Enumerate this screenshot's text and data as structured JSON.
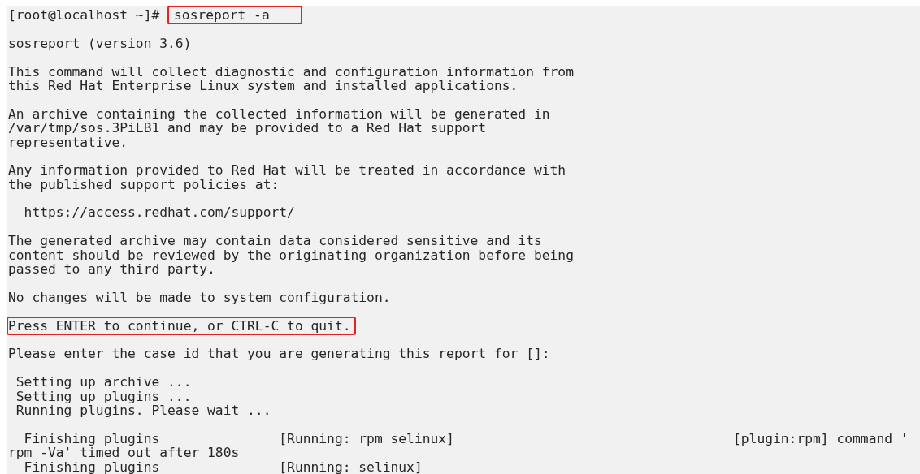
{
  "terminal": {
    "lines": [
      {
        "kind": "prompt",
        "prompt": "[root@localhost ~]#",
        "command": "sosreport -a",
        "highlighted": true
      },
      {
        "kind": "blank"
      },
      {
        "kind": "output",
        "text": "sosreport (version 3.6)",
        "highlighted": false
      },
      {
        "kind": "blank"
      },
      {
        "kind": "output",
        "text": "This command will collect diagnostic and configuration information from",
        "highlighted": false
      },
      {
        "kind": "output",
        "text": "this Red Hat Enterprise Linux system and installed applications.",
        "highlighted": false
      },
      {
        "kind": "blank"
      },
      {
        "kind": "output",
        "text": "An archive containing the collected information will be generated in",
        "highlighted": false
      },
      {
        "kind": "output",
        "text": "/var/tmp/sos.3PiLB1 and may be provided to a Red Hat support",
        "highlighted": false
      },
      {
        "kind": "output",
        "text": "representative.",
        "highlighted": false
      },
      {
        "kind": "blank"
      },
      {
        "kind": "output",
        "text": "Any information provided to Red Hat will be treated in accordance with",
        "highlighted": false
      },
      {
        "kind": "output",
        "text": "the published support policies at:",
        "highlighted": false
      },
      {
        "kind": "blank"
      },
      {
        "kind": "output",
        "text": "  https://access.redhat.com/support/",
        "highlighted": false
      },
      {
        "kind": "blank"
      },
      {
        "kind": "output",
        "text": "The generated archive may contain data considered sensitive and its",
        "highlighted": false
      },
      {
        "kind": "output",
        "text": "content should be reviewed by the originating organization before being",
        "highlighted": false
      },
      {
        "kind": "output",
        "text": "passed to any third party.",
        "highlighted": false
      },
      {
        "kind": "blank"
      },
      {
        "kind": "output",
        "text": "No changes will be made to system configuration.",
        "highlighted": false
      },
      {
        "kind": "blank"
      },
      {
        "kind": "output",
        "text": "Press ENTER to continue, or CTRL-C to quit.",
        "highlighted": true
      },
      {
        "kind": "blank"
      },
      {
        "kind": "output",
        "text": "Please enter the case id that you are generating this report for []:",
        "highlighted": false
      },
      {
        "kind": "blank"
      },
      {
        "kind": "output",
        "text": " Setting up archive ...",
        "highlighted": false
      },
      {
        "kind": "output",
        "text": " Setting up plugins ...",
        "highlighted": false
      },
      {
        "kind": "output",
        "text": " Running plugins. Please wait ...",
        "highlighted": false
      },
      {
        "kind": "blank"
      },
      {
        "kind": "output",
        "text": "  Finishing plugins               [Running: rpm selinux]                                   [plugin:rpm] command '",
        "highlighted": false
      },
      {
        "kind": "output",
        "text": "rpm -Va' timed out after 180s",
        "highlighted": false
      },
      {
        "kind": "output",
        "text": "  Finishing plugins               [Running: selinux]",
        "highlighted": false
      }
    ]
  }
}
